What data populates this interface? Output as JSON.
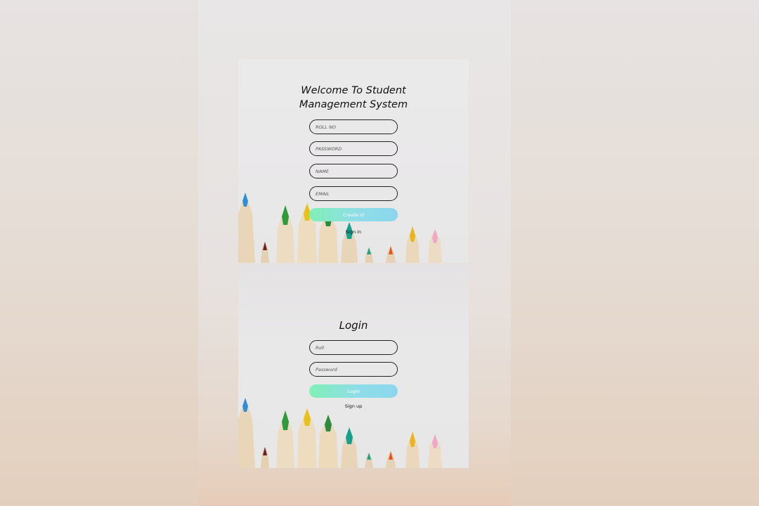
{
  "register": {
    "title_line1": "Welcome To Student",
    "title_line2": "Management System",
    "fields": {
      "roll_no": {
        "placeholder": "ROLL NO",
        "value": ""
      },
      "password": {
        "placeholder": "PASSWORD",
        "value": ""
      },
      "name": {
        "placeholder": "NAME",
        "value": ""
      },
      "email": {
        "placeholder": "EMAIL",
        "value": ""
      }
    },
    "submit_label": "Create id",
    "switch_label": "Sign in"
  },
  "login": {
    "title": "Login",
    "fields": {
      "roll": {
        "placeholder": "Roll",
        "value": ""
      },
      "password": {
        "placeholder": "Password",
        "value": ""
      }
    },
    "submit_label": "Login",
    "switch_label": "Sign up"
  },
  "colors": {
    "button_gradient_start": "#7ff0b6",
    "button_gradient_end": "#8bd6ef",
    "field_border": "#222222"
  },
  "decoration": {
    "background_image": "colored-pencils"
  }
}
